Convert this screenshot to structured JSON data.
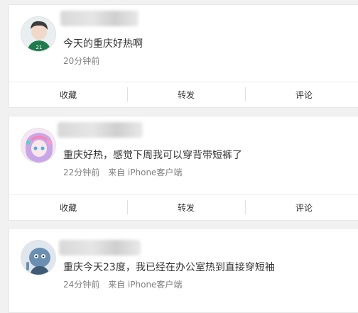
{
  "posts": [
    {
      "text": "今天的重庆好热啊",
      "time": "20分钟前",
      "source": "",
      "actions": {
        "fav": "收藏",
        "repost": "转发",
        "comment": "评论"
      }
    },
    {
      "text": "重庆好热，感觉下周我可以穿背带短裤了",
      "time": "22分钟前",
      "source": "来自 iPhone客户端",
      "actions": {
        "fav": "收藏",
        "repost": "转发",
        "comment": "评论"
      }
    },
    {
      "text": "重庆今天23度，我已经在办公室热到直接穿短袖",
      "time": "24分钟前",
      "source": "来自 iPhone客户端"
    }
  ]
}
